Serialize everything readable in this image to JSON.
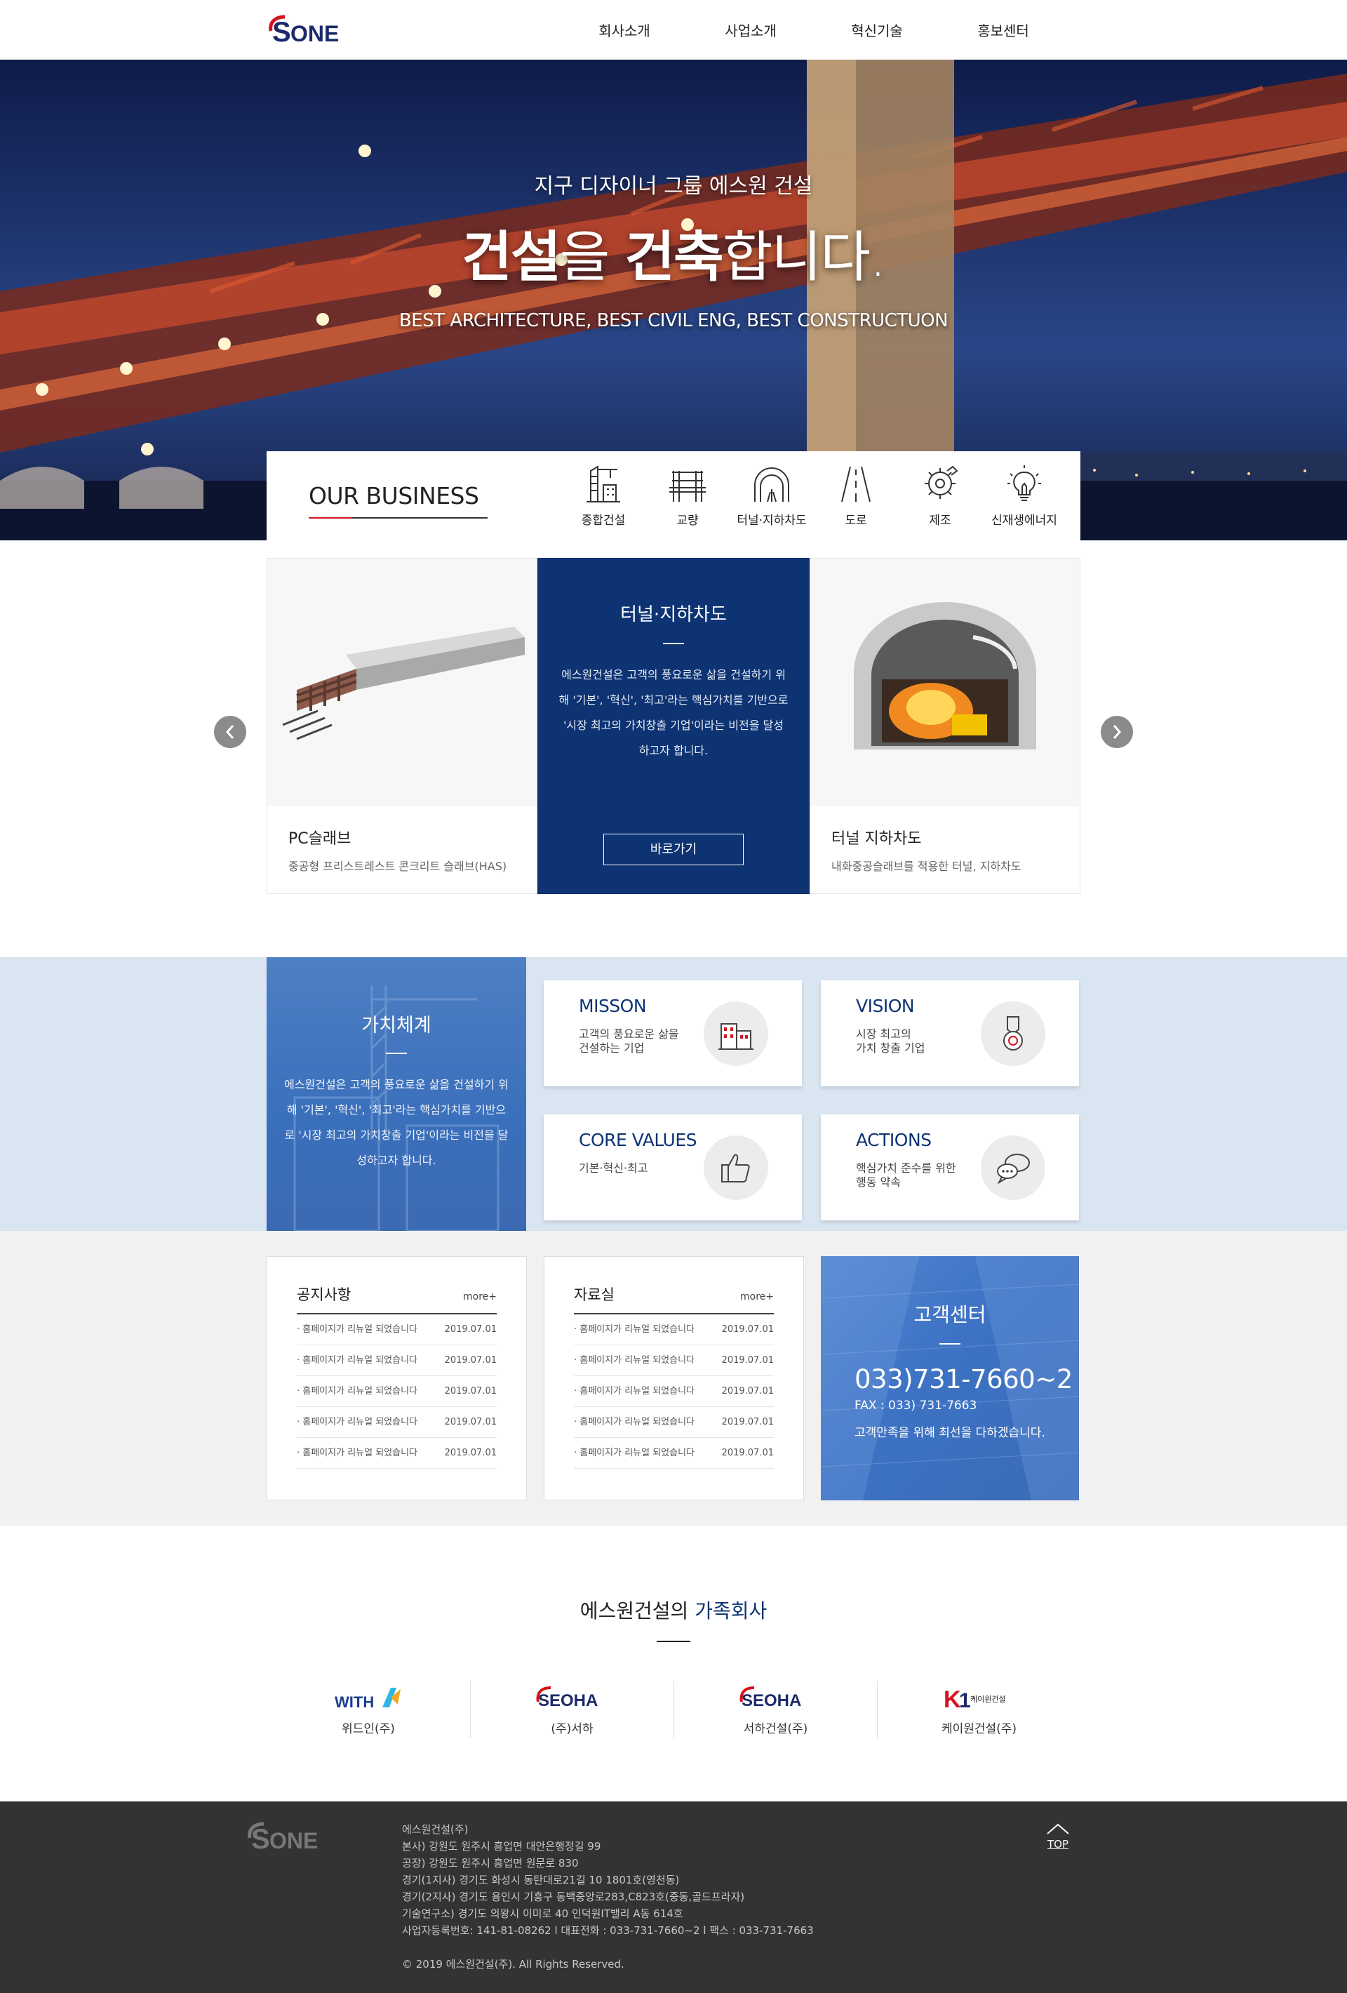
{
  "header": {
    "nav": [
      "회사소개",
      "사업소개",
      "혁신기술",
      "홍보센터"
    ]
  },
  "hero": {
    "subtitle": "지구 디자이너 그룹 에스원 건설",
    "title_part1": "건설",
    "title_part2": "을 ",
    "title_part3": "건축",
    "title_part4": "합니다.",
    "english": "BEST ARCHITECTURE, BEST CIVIL ENG, BEST CONSTRUCTUON"
  },
  "business": {
    "title": "OUR BUSINESS",
    "items": [
      "종합건설",
      "교량",
      "터널·지하차도",
      "도로",
      "제조",
      "신재생에너지"
    ]
  },
  "slider": {
    "left": {
      "title": "PC슬래브",
      "desc": "중공형 프리스트레스트 콘크리트 슬래브(HAS)"
    },
    "center": {
      "title": "터널·지하차도",
      "desc": "에스원건설은 고객의 풍요로운 삶을 건설하기 위해 '기본', '혁신', '최고'라는 핵심가치를 기반으로 '시장 최고의 가치창출 기업'이라는 비전을 달성하고자 합니다.",
      "button": "바로가기"
    },
    "right": {
      "title": "터널 지하차도",
      "desc": "내화중공슬래브를 적용한 터널, 지하차도"
    }
  },
  "values": {
    "title": "가치체계",
    "desc": "에스원건설은 고객의 풍요로운 삶을 건설하기 위해 '기본', '혁신', '최고'라는 핵심가치를 기반으로 '시장 최고의 가치창출 기업'이라는 비전을 달성하고자 합니다.",
    "cards": [
      {
        "title": "MISSON",
        "desc": "고객의 풍요로운 삶을\n건설하는 기업",
        "icon": "building-icon"
      },
      {
        "title": "VISION",
        "desc": "시장 최고의\n가치 창출 기업",
        "icon": "medal-icon"
      },
      {
        "title": "CORE VALUES",
        "desc": "기본·혁신·최고",
        "icon": "thumbs-up-icon"
      },
      {
        "title": "ACTIONS",
        "desc": "핵심가치 준수를 위한\n행동 약속",
        "icon": "chat-icon"
      }
    ]
  },
  "board": {
    "notice": {
      "title": "공지사항",
      "more": "more+",
      "rows": [
        {
          "text": "· 홈페이지가 리뉴얼 되었습니다",
          "date": "2019.07.01"
        },
        {
          "text": "· 홈페이지가 리뉴얼 되었습니다",
          "date": "2019.07.01"
        },
        {
          "text": "· 홈페이지가 리뉴얼 되었습니다",
          "date": "2019.07.01"
        },
        {
          "text": "· 홈페이지가 리뉴얼 되었습니다",
          "date": "2019.07.01"
        },
        {
          "text": "· 홈페이지가 리뉴얼 되었습니다",
          "date": "2019.07.01"
        }
      ]
    },
    "archive": {
      "title": "자료실",
      "more": "more+",
      "rows": [
        {
          "text": "· 홈페이지가 리뉴얼 되었습니다",
          "date": "2019.07.01"
        },
        {
          "text": "· 홈페이지가 리뉴얼 되었습니다",
          "date": "2019.07.01"
        },
        {
          "text": "· 홈페이지가 리뉴얼 되었습니다",
          "date": "2019.07.01"
        },
        {
          "text": "· 홈페이지가 리뉴얼 되었습니다",
          "date": "2019.07.01"
        },
        {
          "text": "· 홈페이지가 리뉴얼 되었습니다",
          "date": "2019.07.01"
        }
      ]
    },
    "customer": {
      "title": "고객센터",
      "tel": "033)731-7660~2",
      "fax": "FAX : 033) 731-7663",
      "message": "고객만족을 위해 최선을 다하겠습니다."
    }
  },
  "family": {
    "title_prefix": "에스원건설의 ",
    "title_highlight": "가족회사",
    "companies": [
      {
        "logo_text": "WITH",
        "name": "위드인(주)"
      },
      {
        "logo_text": "SEOHA",
        "name": "(주)서하"
      },
      {
        "logo_text": "SEOHA",
        "name": "서하건설(주)"
      },
      {
        "logo_text": "케이원건설",
        "name": "케이원건설(주)"
      }
    ]
  },
  "footer": {
    "lines": [
      "에스원건설(주)",
      "본사) 강원도 원주시 흥업면 대안은행정길 99",
      "공장) 강원도 원주시 흥업면 원문로 830",
      "경기(1지사) 경기도 화성시 동탄대로21길 10 1801호(영천동)",
      "경기(2지사) 경기도 용인시 기흥구 동백중앙로283,C823호(중동,골드프라자)",
      "기술연구소) 경기도 의왕시 이미로 40 인덕원IT밸리 A동 614호",
      "사업자등록번호: 141-81-08262 l 대표전화 : 033-731-7660~2 l 팩스 : 033-731-7663"
    ],
    "copyright": "© 2019 에스원건설(주). All Rights Reserved.",
    "top": "TOP"
  },
  "colors": {
    "navy": "#0d3373",
    "blue": "#3d72c4",
    "red": "#d5121e",
    "footer": "#333333"
  }
}
